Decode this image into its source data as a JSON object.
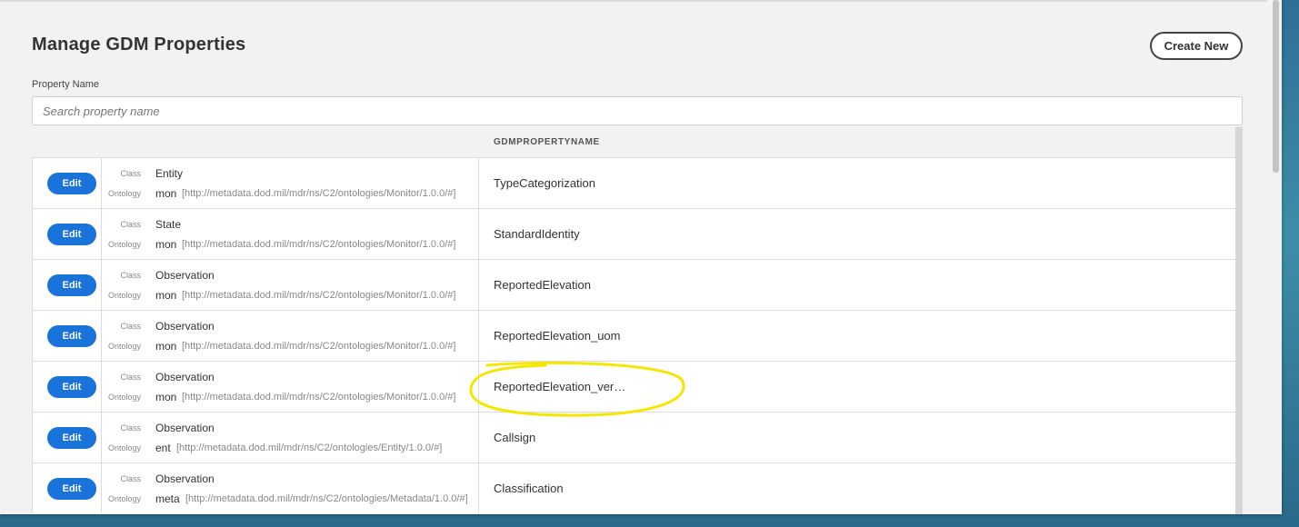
{
  "page": {
    "title": "Manage GDM Properties",
    "create_label": "Create New"
  },
  "filter": {
    "label": "Property Name",
    "placeholder": "Search property name",
    "value": ""
  },
  "table": {
    "column_header": "GDMPROPERTYNAME",
    "class_label": "Class",
    "ontology_label": "Ontology",
    "edit_label": "Edit",
    "rows": [
      {
        "class": "Entity",
        "prefix": "mon",
        "uri": "[http://metadata.dod.mil/mdr/ns/C2/ontologies/Monitor/1.0.0/#]",
        "name": "TypeCategorization"
      },
      {
        "class": "State",
        "prefix": "mon",
        "uri": "[http://metadata.dod.mil/mdr/ns/C2/ontologies/Monitor/1.0.0/#]",
        "name": "StandardIdentity"
      },
      {
        "class": "Observation",
        "prefix": "mon",
        "uri": "[http://metadata.dod.mil/mdr/ns/C2/ontologies/Monitor/1.0.0/#]",
        "name": "ReportedElevation"
      },
      {
        "class": "Observation",
        "prefix": "mon",
        "uri": "[http://metadata.dod.mil/mdr/ns/C2/ontologies/Monitor/1.0.0/#]",
        "name": "ReportedElevation_uom"
      },
      {
        "class": "Observation",
        "prefix": "mon",
        "uri": "[http://metadata.dod.mil/mdr/ns/C2/ontologies/Monitor/1.0.0/#]",
        "name": "ReportedElevation_ver…",
        "highlighted": true
      },
      {
        "class": "Observation",
        "prefix": "ent",
        "uri": "[http://metadata.dod.mil/mdr/ns/C2/ontologies/Entity/1.0.0/#]",
        "name": "Callsign"
      },
      {
        "class": "Observation",
        "prefix": "meta",
        "uri": "[http://metadata.dod.mil/mdr/ns/C2/ontologies/Metadata/1.0.0/#]",
        "name": "Classification"
      }
    ]
  },
  "colors": {
    "edit_button": "#1a73d9",
    "highlight": "#f5e600"
  }
}
